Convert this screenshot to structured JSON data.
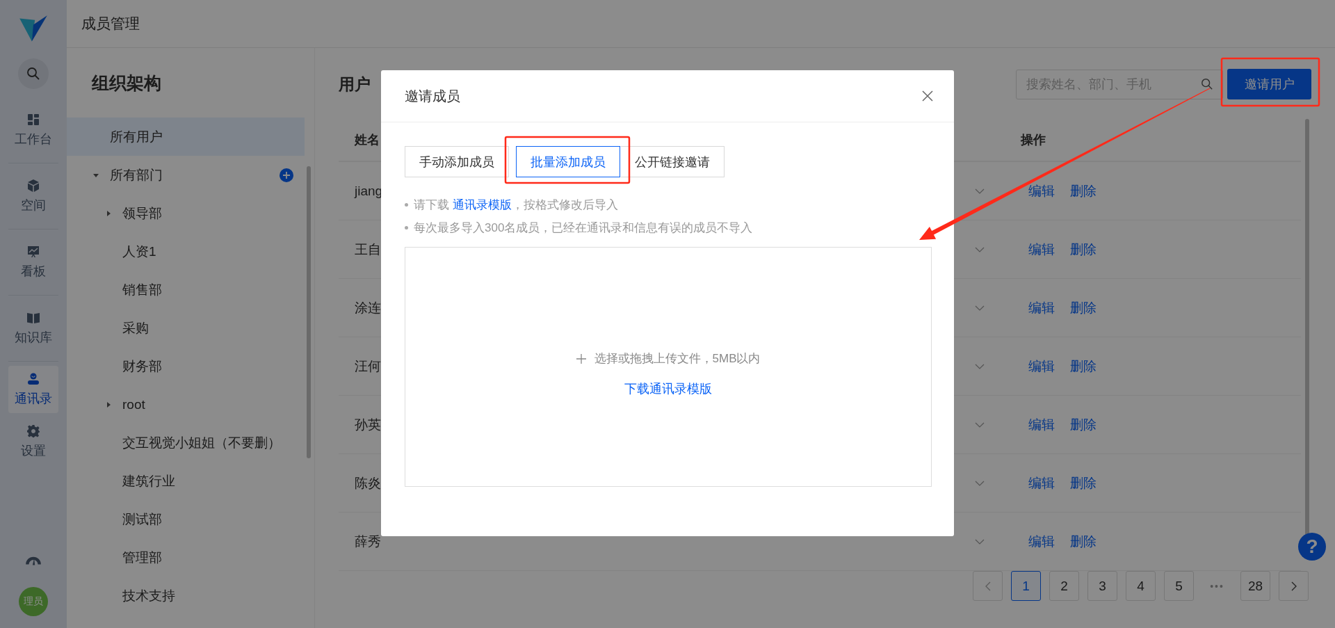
{
  "app_rail": {
    "items": [
      {
        "label": "工作台",
        "selected": false
      },
      {
        "label": "空间",
        "selected": false
      },
      {
        "label": "看板",
        "selected": false
      },
      {
        "label": "知识库",
        "selected": false
      },
      {
        "label": "通讯录",
        "selected": true
      },
      {
        "label": "设置",
        "selected": false
      }
    ],
    "avatar": "理员"
  },
  "header": {
    "title": "成员管理"
  },
  "org_sidebar": {
    "title": "组织架构",
    "items": [
      {
        "label": "所有用户",
        "selected": true
      },
      {
        "label": "所有部门",
        "selected": false,
        "expanded": true,
        "children": [
          {
            "label": "领导部",
            "selected": false,
            "expanded": false
          },
          {
            "label": "人资1",
            "selected": false
          },
          {
            "label": "销售部",
            "selected": false
          },
          {
            "label": "采购",
            "selected": false
          },
          {
            "label": "财务部",
            "selected": false
          },
          {
            "label": "root",
            "selected": false,
            "expanded": false
          },
          {
            "label": "交互视觉小姐姐（不要删）",
            "selected": false
          },
          {
            "label": "建筑行业",
            "selected": false
          },
          {
            "label": "测试部",
            "selected": false
          },
          {
            "label": "管理部",
            "selected": false
          },
          {
            "label": "技术支持",
            "selected": false
          }
        ]
      }
    ]
  },
  "users": {
    "title": "用户",
    "search": {
      "placeholder": "搜索姓名、部门、手机"
    },
    "invite_button": "邀请用户",
    "columns": [
      "姓名",
      "操作"
    ],
    "rows": [
      {
        "name": "jiang",
        "actions": [
          "编辑",
          "删除"
        ]
      },
      {
        "name": "王自",
        "actions": [
          "编辑",
          "删除"
        ]
      },
      {
        "name": "涂连",
        "actions": [
          "编辑",
          "删除"
        ]
      },
      {
        "name": "汪何",
        "actions": [
          "编辑",
          "删除"
        ]
      },
      {
        "name": "孙英",
        "actions": [
          "编辑",
          "删除"
        ]
      },
      {
        "name": "陈炎",
        "actions": [
          "编辑",
          "删除"
        ]
      },
      {
        "name": "薛秀",
        "actions": [
          "编辑",
          "删除"
        ]
      }
    ],
    "pagination": [
      {
        "kind": "page",
        "label": "1",
        "selected": true
      },
      {
        "kind": "page",
        "label": "2",
        "selected": false
      },
      {
        "kind": "page",
        "label": "3",
        "selected": false
      },
      {
        "kind": "page",
        "label": "4",
        "selected": false
      },
      {
        "kind": "page",
        "label": "5",
        "selected": false
      },
      {
        "kind": "ellipsis",
        "label": "•••"
      },
      {
        "kind": "page",
        "label": "28",
        "selected": false
      }
    ]
  },
  "help_button": "?",
  "dialog": {
    "title": "邀请成员",
    "tabs": [
      {
        "label": "手动添加成员",
        "selected": false
      },
      {
        "label": "批量添加成员",
        "selected": true
      },
      {
        "label": "公开链接邀请",
        "selected": false
      }
    ],
    "hints": [
      {
        "kind": "link",
        "before": "请下载 ",
        "link": "通讯录模版",
        "after": "，按格式修改后导入"
      },
      {
        "kind": "plain",
        "text": "每次最多导入300名成员，已经在通讯录和信息有误的成员不导入"
      }
    ],
    "dropzone": {
      "text": "选择或拖拽上传文件，5MB以内",
      "link": "下载通讯录模版"
    }
  }
}
